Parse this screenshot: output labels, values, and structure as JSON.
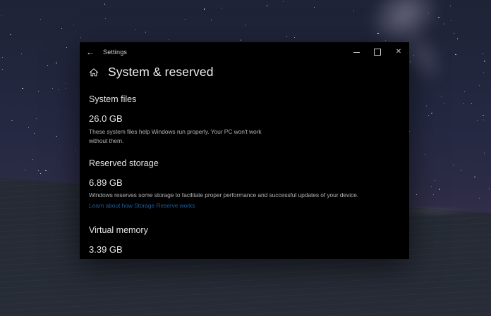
{
  "desktop": {
    "wallpaper": "starry-night-sky-over-dark-ground",
    "colors": {
      "sky_top": "#1f2336",
      "sky_horizon": "#473a53",
      "ground": "#252a34"
    }
  },
  "window": {
    "colors": {
      "background": "#000000",
      "text": "#e4e4e4",
      "secondary_text": "#b0b0b0",
      "link": "#1a5c96"
    },
    "titlebar": {
      "back_icon": "←",
      "title": "Settings",
      "close_icon": "✕"
    },
    "page": {
      "icon": "home-icon",
      "title": "System & reserved"
    },
    "sections": [
      {
        "title": "System files",
        "value": "26.0 GB",
        "description": "These system files help Windows run properly. Your PC won't work without them."
      },
      {
        "title": "Reserved storage",
        "value": "6.89 GB",
        "description": "Windows reserves some storage to facilitate proper performance and successful updates of your device.",
        "link_text": "Learn about how Storage Reserve works"
      },
      {
        "title": "Virtual memory",
        "value": "3.39 GB"
      }
    ]
  }
}
